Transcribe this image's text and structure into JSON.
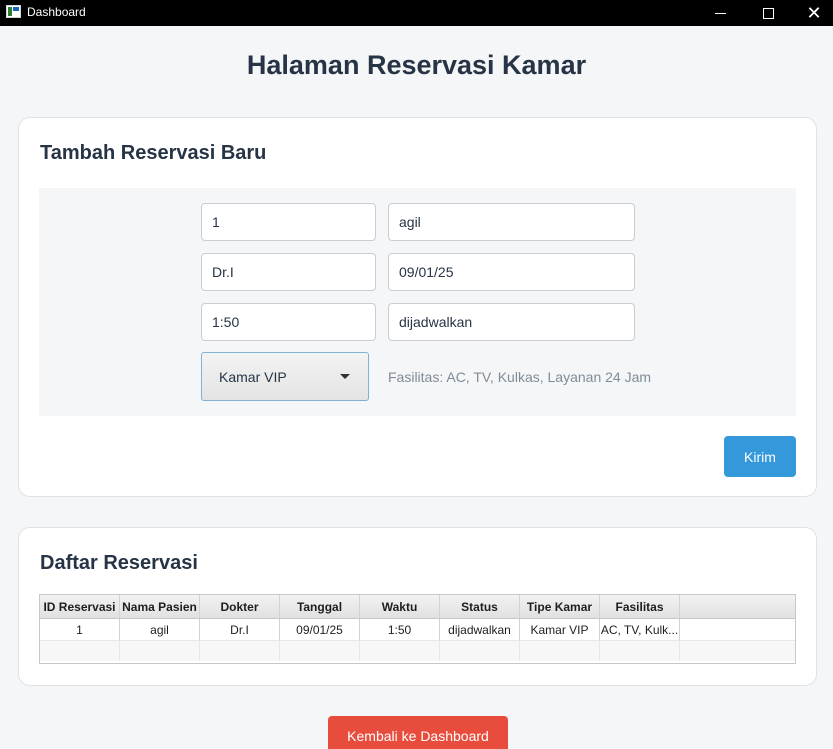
{
  "window": {
    "title": "Dashboard",
    "close_glyph": "✕"
  },
  "page": {
    "title": "Halaman Reservasi Kamar"
  },
  "form": {
    "title": "Tambah Reservasi Baru",
    "fields": {
      "id": "1",
      "nama_pasien": "agil",
      "dokter": "Dr.I",
      "tanggal": "09/01/25",
      "waktu": "1:50",
      "status": "dijadwalkan"
    },
    "tipe_kamar": {
      "selected": "Kamar VIP"
    },
    "fasilitas_text": "Fasilitas: AC, TV, Kulkas, Layanan 24 Jam",
    "submit_label": "Kirim"
  },
  "list": {
    "title": "Daftar Reservasi",
    "columns": [
      "ID Reservasi",
      "Nama Pasien",
      "Dokter",
      "Tanggal",
      "Waktu",
      "Status",
      "Tipe Kamar",
      "Fasilitas"
    ],
    "rows": [
      [
        "1",
        "agil",
        "Dr.I",
        "09/01/25",
        "1:50",
        "dijadwalkan",
        "Kamar VIP",
        "AC, TV, Kulk..."
      ]
    ]
  },
  "footer": {
    "back_label": "Kembali ke Dashboard"
  },
  "colors": {
    "primary": "#3498db",
    "danger": "#e74c3c",
    "heading": "#263445",
    "titlebar": "#000000"
  }
}
